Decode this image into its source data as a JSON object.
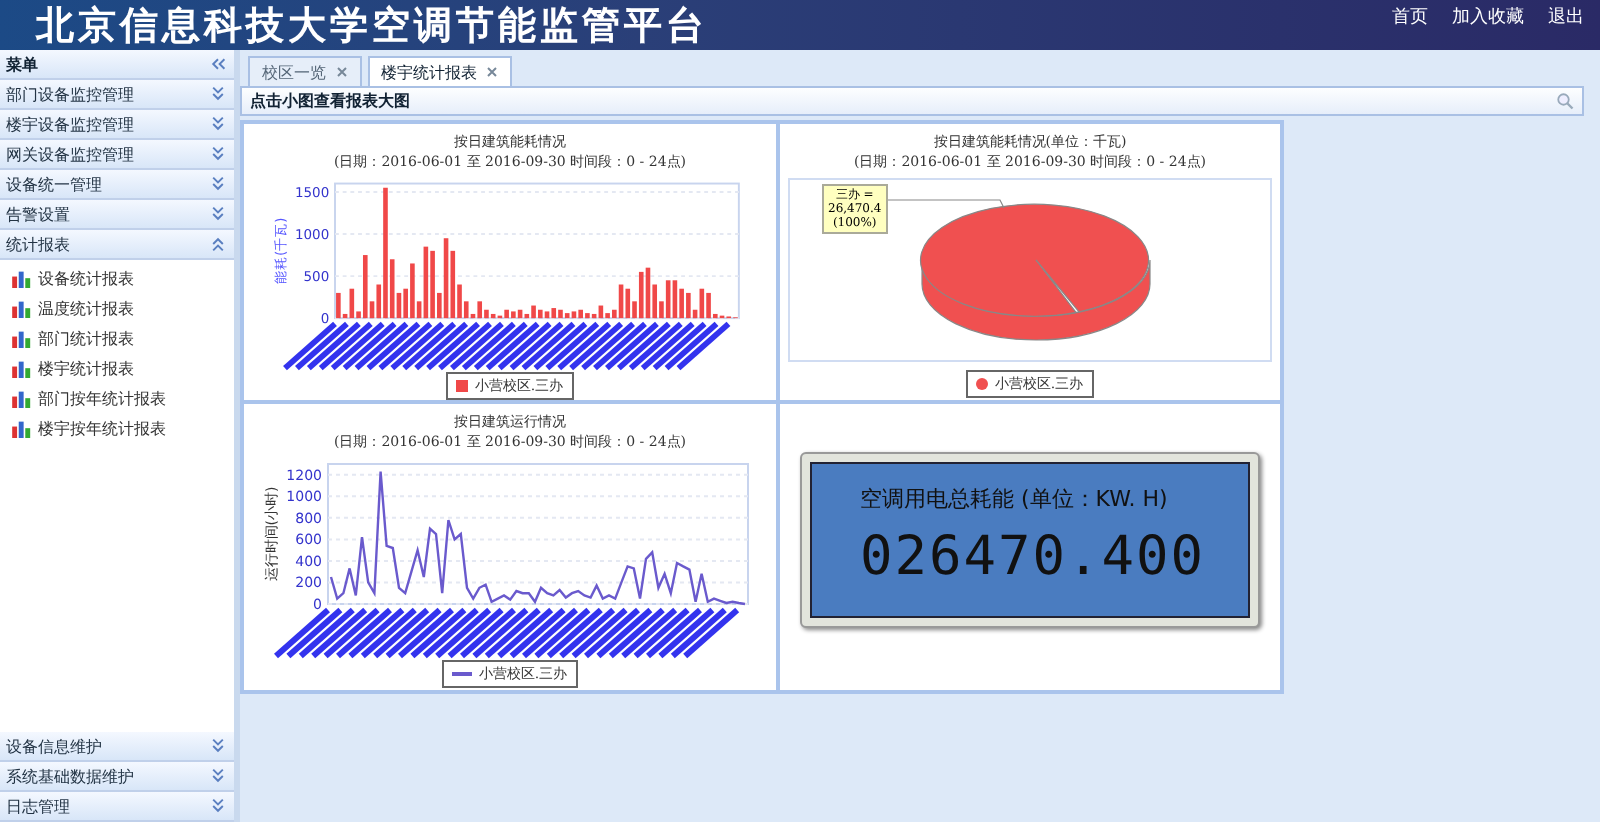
{
  "header": {
    "title": "北京信息科技大学空调节能监管平台",
    "links": [
      "首页",
      "加入收藏",
      "退出"
    ]
  },
  "sidebar": {
    "title": "菜单",
    "groups": [
      {
        "label": "部门设备监控管理",
        "expanded": false
      },
      {
        "label": "楼宇设备监控管理",
        "expanded": false
      },
      {
        "label": "网关设备监控管理",
        "expanded": false
      },
      {
        "label": "设备统一管理",
        "expanded": false
      },
      {
        "label": "告警设置",
        "expanded": false
      },
      {
        "label": "统计报表",
        "expanded": true,
        "items": [
          "设备统计报表",
          "温度统计报表",
          "部门统计报表",
          "楼宇统计报表",
          "部门按年统计报表",
          "楼宇按年统计报表"
        ]
      }
    ],
    "bottom_groups": [
      {
        "label": "设备信息维护",
        "expanded": false
      },
      {
        "label": "系统基础数据维护",
        "expanded": false
      },
      {
        "label": "日志管理",
        "expanded": false
      }
    ]
  },
  "tabs": [
    {
      "label": "校区一览",
      "selected": false
    },
    {
      "label": "楼宇统计报表",
      "selected": true
    }
  ],
  "toolbar": {
    "hint": "点击小图查看报表大图"
  },
  "panels": [
    {
      "title": "按日建筑能耗情况",
      "subtitle": "(日期：2016-06-01  至  2016-09-30  时间段：0 - 24点)",
      "chart_data": {
        "type": "bar",
        "ylabel": "能耗(千瓦)",
        "ylim": [
          0,
          1600
        ],
        "yticks": [
          0,
          500,
          1000,
          1500
        ],
        "grid": true,
        "series": [
          {
            "name": "小营校区.三办",
            "color": "#f04848",
            "values": [
              300,
              50,
              350,
              80,
              750,
              200,
              400,
              1550,
              700,
              300,
              350,
              650,
              200,
              850,
              800,
              300,
              950,
              800,
              400,
              200,
              50,
              200,
              100,
              50,
              30,
              100,
              80,
              100,
              50,
              150,
              100,
              80,
              120,
              100,
              60,
              80,
              100,
              60,
              50,
              150,
              60,
              100,
              400,
              350,
              200,
              550,
              600,
              400,
              200,
              450,
              450,
              350,
              300,
              100,
              350,
              300,
              50,
              30,
              20,
              10
            ]
          }
        ]
      }
    },
    {
      "title": "按日建筑能耗情况(单位：千瓦)",
      "subtitle": "(日期：2016-06-01  至  2016-09-30  时间段：0 - 24点)",
      "callout": [
        "三办 =",
        "26,470.4",
        "(100%)"
      ],
      "chart_data": {
        "type": "pie",
        "categories": [
          "小营校区.三办"
        ],
        "series": [
          {
            "color": "#f05050",
            "values": [
              100
            ]
          }
        ]
      }
    },
    {
      "title": "按日建筑运行情况",
      "subtitle": "(日期：2016-06-01  至  2016-09-30  时间段：0 - 24点)",
      "chart_data": {
        "type": "line",
        "ylabel": "运行时间(小时)",
        "ylim": [
          0,
          1300
        ],
        "yticks": [
          0,
          200,
          400,
          600,
          800,
          1000,
          1200
        ],
        "grid": true,
        "series": [
          {
            "name": "小营校区.三办",
            "color": "#6a5acd",
            "values": [
              250,
              50,
              100,
              330,
              80,
              620,
              200,
              100,
              1230,
              540,
              520,
              150,
              100,
              300,
              500,
              250,
              700,
              650,
              100,
              780,
              600,
              650,
              150,
              50,
              150,
              180,
              20,
              50,
              80,
              40,
              120,
              100,
              100,
              20,
              150,
              100,
              80,
              130,
              60,
              100,
              120,
              80,
              60,
              170,
              50,
              80,
              50,
              200,
              350,
              330,
              50,
              420,
              480,
              150,
              280,
              100,
              380,
              350,
              320,
              20,
              280,
              20,
              50,
              30,
              10,
              20,
              10,
              0
            ]
          }
        ]
      }
    },
    {
      "kind": "meter",
      "label": "空调用电总耗能 (单位：KW. H)",
      "reading": "026470.400"
    }
  ]
}
